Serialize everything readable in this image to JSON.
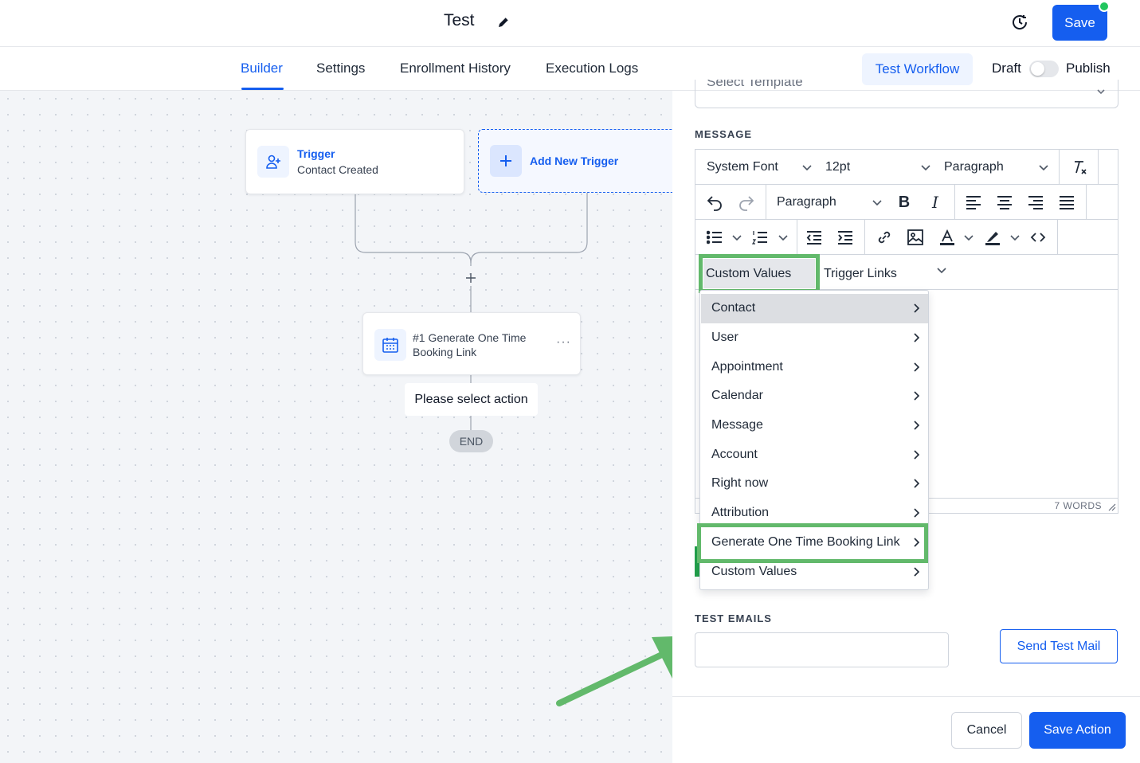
{
  "header": {
    "title": "Test",
    "save_label": "Save"
  },
  "tabs": [
    {
      "label": "Builder",
      "active": true
    },
    {
      "label": "Settings"
    },
    {
      "label": "Enrollment History"
    },
    {
      "label": "Execution Logs"
    }
  ],
  "actions": {
    "test_workflow": "Test Workflow",
    "draft": "Draft",
    "publish": "Publish"
  },
  "canvas": {
    "trigger": {
      "label": "Trigger",
      "sub": "Contact Created"
    },
    "add_trigger": "Add New Trigger",
    "action_node": "#1 Generate One Time Booking Link",
    "please_select": "Please select action",
    "end": "END"
  },
  "panel": {
    "select_template_placeholder": "Select Template",
    "message_label": "MESSAGE",
    "toolbar": {
      "font": "System Font",
      "size": "12pt",
      "block": "Paragraph",
      "block2": "Paragraph",
      "custom_values": "Custom Values",
      "trigger_links": "Trigger Links"
    },
    "word_count": "7 WORDS",
    "test_emails_label": "TEST EMAILS",
    "send_test": "Send Test Mail",
    "cancel": "Cancel",
    "save_action": "Save Action"
  },
  "dropdown": {
    "items": [
      {
        "label": "Contact",
        "highlighted": true
      },
      {
        "label": "User"
      },
      {
        "label": "Appointment"
      },
      {
        "label": "Calendar"
      },
      {
        "label": "Message"
      },
      {
        "label": "Account"
      },
      {
        "label": "Right now"
      },
      {
        "label": "Attribution"
      },
      {
        "label": "Generate One Time Booking Link",
        "callout": true
      },
      {
        "label": "Custom Values"
      }
    ]
  },
  "colors": {
    "accent": "#155eef",
    "callout": "#62b96b",
    "online": "#22c55e"
  }
}
